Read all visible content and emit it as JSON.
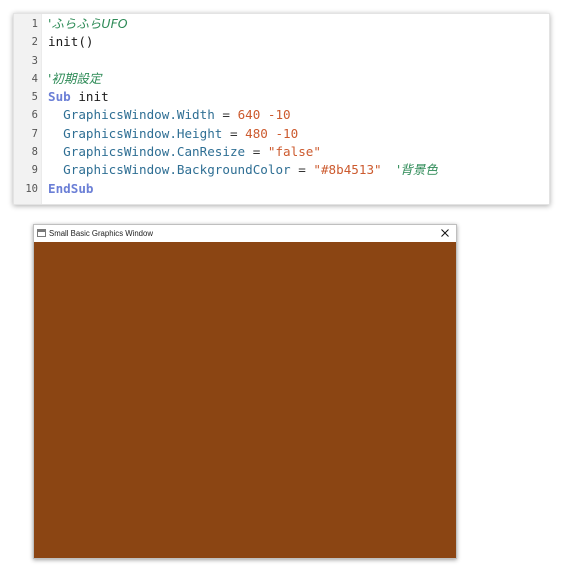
{
  "editor": {
    "lines": [
      {
        "num": "1",
        "tokens": [
          {
            "t": "'ふらふらUFO",
            "c": "cmt"
          }
        ]
      },
      {
        "num": "2",
        "tokens": [
          {
            "t": "init()",
            "c": "plain"
          }
        ]
      },
      {
        "num": "3",
        "tokens": []
      },
      {
        "num": "4",
        "tokens": [
          {
            "t": "'初期設定",
            "c": "cmt"
          }
        ]
      },
      {
        "num": "5",
        "tokens": [
          {
            "t": "Sub",
            "c": "kw"
          },
          {
            "t": " init",
            "c": "plain"
          }
        ]
      },
      {
        "num": "6",
        "tokens": [
          {
            "t": "  GraphicsWindow.Width",
            "c": "obj"
          },
          {
            "t": " = ",
            "c": "op"
          },
          {
            "t": "640 -10",
            "c": "num"
          }
        ]
      },
      {
        "num": "7",
        "tokens": [
          {
            "t": "  GraphicsWindow.Height",
            "c": "obj"
          },
          {
            "t": " = ",
            "c": "op"
          },
          {
            "t": "480 -10",
            "c": "num"
          }
        ]
      },
      {
        "num": "8",
        "tokens": [
          {
            "t": "  GraphicsWindow.CanResize",
            "c": "obj"
          },
          {
            "t": " = ",
            "c": "op"
          },
          {
            "t": "\"false\"",
            "c": "str"
          }
        ]
      },
      {
        "num": "9",
        "tokens": [
          {
            "t": "  GraphicsWindow.BackgroundColor",
            "c": "obj"
          },
          {
            "t": " = ",
            "c": "op"
          },
          {
            "t": "\"#8b4513\"",
            "c": "str"
          },
          {
            "t": "  ",
            "c": "plain"
          },
          {
            "t": "'背景色",
            "c": "cmt"
          }
        ]
      },
      {
        "num": "10",
        "tokens": [
          {
            "t": "EndSub",
            "c": "kw"
          }
        ]
      }
    ]
  },
  "graphics_window": {
    "title": "Small Basic Graphics Window",
    "icon": "app-window-icon",
    "close_icon": "close-icon",
    "background_color": "#8b4513"
  }
}
